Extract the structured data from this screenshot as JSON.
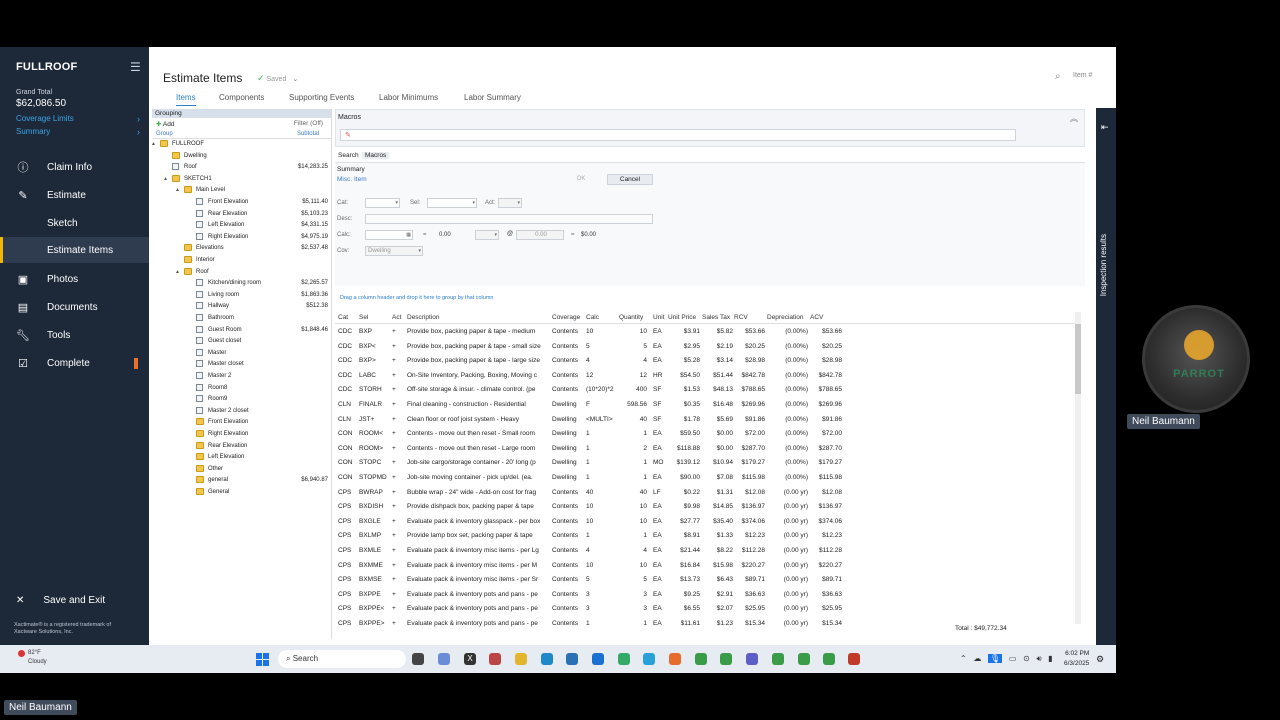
{
  "sidebar": {
    "brand": "FULLROOF",
    "grand_total_label": "Grand Total",
    "grand_total_value": "$62,086.50",
    "coverage_limits": "Coverage Limits",
    "summary": "Summary",
    "items": [
      {
        "label": "Claim Info",
        "icon": "info-icon"
      },
      {
        "label": "Estimate",
        "icon": "pencil-icon"
      },
      {
        "label": "Sketch"
      },
      {
        "label": "Estimate Items"
      },
      {
        "label": "Photos",
        "icon": "photo-icon"
      },
      {
        "label": "Documents",
        "icon": "document-icon"
      },
      {
        "label": "Tools",
        "icon": "wrench-icon"
      },
      {
        "label": "Complete",
        "icon": "checkbox-icon"
      }
    ],
    "save_exit": "Save and Exit",
    "trademark": "Xactimate® is a registered trademark of Xactware Solutions, Inc."
  },
  "header": {
    "title": "Estimate Items",
    "saved": "Saved",
    "item_search": "Item #"
  },
  "tabs": [
    "Items",
    "Components",
    "Supporting Events",
    "Labor Minimums",
    "Labor Summary"
  ],
  "grouping": {
    "title": "Grouping",
    "add": "Add",
    "filter": "Filter (Off)",
    "col_group": "Group",
    "col_subtotal": "Subtotal",
    "tree": [
      {
        "label": "FULLROOF",
        "value": "",
        "type": "folder",
        "level": 0,
        "toggle": "▲"
      },
      {
        "label": "Dwelling",
        "value": "",
        "type": "folder",
        "level": 1,
        "toggle": ""
      },
      {
        "label": "Roof",
        "value": "$14,283.25",
        "type": "room",
        "level": 1,
        "toggle": ""
      },
      {
        "label": "SKETCH1",
        "value": "",
        "type": "folder",
        "level": 1,
        "toggle": "▲"
      },
      {
        "label": "Main Level",
        "value": "",
        "type": "folder",
        "level": 2,
        "toggle": "▲"
      },
      {
        "label": "Front Elevation",
        "value": "$5,111.40",
        "type": "room",
        "level": 3,
        "toggle": ""
      },
      {
        "label": "Rear Elevation",
        "value": "$5,103.23",
        "type": "room",
        "level": 3,
        "toggle": ""
      },
      {
        "label": "Left Elevation",
        "value": "$4,331.15",
        "type": "room",
        "level": 3,
        "toggle": ""
      },
      {
        "label": "Right Elevation",
        "value": "$4,975.19",
        "type": "room",
        "level": 3,
        "toggle": ""
      },
      {
        "label": "Elevations",
        "value": "$2,537.48",
        "type": "folder",
        "level": 2,
        "toggle": ""
      },
      {
        "label": "Interior",
        "value": "",
        "type": "folder",
        "level": 2,
        "toggle": ""
      },
      {
        "label": "Roof",
        "value": "",
        "type": "folder",
        "level": 2,
        "toggle": "▲"
      },
      {
        "label": "Kitchen/dining room",
        "value": "$2,265.57",
        "type": "room",
        "level": 3,
        "toggle": ""
      },
      {
        "label": "Living room",
        "value": "$1,863.36",
        "type": "room",
        "level": 3,
        "toggle": ""
      },
      {
        "label": "Hallway",
        "value": "$512.38",
        "type": "room",
        "level": 3,
        "toggle": ""
      },
      {
        "label": "Bathroom",
        "value": "",
        "type": "room",
        "level": 3,
        "toggle": ""
      },
      {
        "label": "Guest Room",
        "value": "$1,848.46",
        "type": "room",
        "level": 3,
        "toggle": ""
      },
      {
        "label": "Guest closet",
        "value": "",
        "type": "room",
        "level": 3,
        "toggle": ""
      },
      {
        "label": "Master",
        "value": "",
        "type": "room",
        "level": 3,
        "toggle": ""
      },
      {
        "label": "Master closet",
        "value": "",
        "type": "room",
        "level": 3,
        "toggle": ""
      },
      {
        "label": "Master 2",
        "value": "",
        "type": "room",
        "level": 3,
        "toggle": ""
      },
      {
        "label": "Room8",
        "value": "",
        "type": "room",
        "level": 3,
        "toggle": ""
      },
      {
        "label": "Room9",
        "value": "",
        "type": "room",
        "level": 3,
        "toggle": ""
      },
      {
        "label": "Master 2 closet",
        "value": "",
        "type": "room",
        "level": 3,
        "toggle": ""
      },
      {
        "label": "Front Elevation",
        "value": "",
        "type": "folder",
        "level": 3,
        "toggle": ""
      },
      {
        "label": "Right Elevation",
        "value": "",
        "type": "folder",
        "level": 3,
        "toggle": ""
      },
      {
        "label": "Rear Elevation",
        "value": "",
        "type": "folder",
        "level": 3,
        "toggle": ""
      },
      {
        "label": "Left Elevation",
        "value": "",
        "type": "folder",
        "level": 3,
        "toggle": ""
      },
      {
        "label": "Other",
        "value": "",
        "type": "folder",
        "level": 3,
        "toggle": ""
      },
      {
        "label": "general",
        "value": "$6,940.87",
        "type": "folder",
        "level": 3,
        "toggle": ""
      },
      {
        "label": "General",
        "value": "",
        "type": "folder",
        "level": 3,
        "toggle": ""
      }
    ]
  },
  "macros": {
    "title": "Macros",
    "subtab_search": "Search",
    "subtab_macros": "Macros"
  },
  "summary": {
    "title": "Summary",
    "misc_item": "Misc. Item",
    "ok": "OK",
    "cancel": "Cancel",
    "cat_label": "Cat:",
    "sel_label": "Sel:",
    "act_label": "Act:",
    "desc_label": "Desc:",
    "calc_label": "Calc:",
    "cov_label": "Cov:",
    "calc_eq": "=",
    "calc_value": "0.00",
    "unit_price": "0.00",
    "at_sign": "@",
    "total_eq": "=",
    "total": "$0.00",
    "cov_value": "Dwelling"
  },
  "grid": {
    "hint": "Drag a column header and drop it here to group by that column",
    "headers": [
      "Cat",
      "Sel",
      "Act",
      "Description",
      "Coverage",
      "Calc",
      "Quantity",
      "Unit",
      "Unit Price",
      "Sales Tax",
      "RCV",
      "Depreciation",
      "ACV"
    ],
    "rows": [
      [
        "CDC",
        "BXP",
        "+",
        "Provide box, packing paper & tape - medium",
        "Contents",
        "10",
        "10",
        "EA",
        "$3.91",
        "$5.82",
        "$53.66",
        "(0.00%)",
        "$53.66"
      ],
      [
        "CDC",
        "BXP<",
        "+",
        "Provide box, packing paper & tape - small size",
        "Contents",
        "5",
        "5",
        "EA",
        "$2.95",
        "$2.19",
        "$20.25",
        "(0.00%)",
        "$20.25"
      ],
      [
        "CDC",
        "BXP>",
        "+",
        "Provide box, packing paper & tape - large size",
        "Contents",
        "4",
        "4",
        "EA",
        "$5.28",
        "$3.14",
        "$28.98",
        "(0.00%)",
        "$28.98"
      ],
      [
        "CDC",
        "LABC",
        "+",
        "On-Site Inventory, Packing, Boxing, Moving c",
        "Contents",
        "12",
        "12",
        "HR",
        "$54.50",
        "$51.44",
        "$842.78",
        "(0.00%)",
        "$842.78"
      ],
      [
        "CDC",
        "STORH",
        "+",
        "Off-site storage & insur. - climate control. (pe",
        "Contents",
        "(10*20)*2",
        "400",
        "SF",
        "$1.53",
        "$48.13",
        "$788.65",
        "(0.00%)",
        "$788.65"
      ],
      [
        "CLN",
        "FINALR",
        "+",
        "Final cleaning - construction - Residential",
        "Dwelling",
        "F",
        "598.56",
        "SF",
        "$0.35",
        "$16.48",
        "$269.96",
        "(0.00%)",
        "$269.96"
      ],
      [
        "CLN",
        "JST+",
        "+",
        "Clean floor or roof joist system - Heavy",
        "Dwelling",
        "<MULTI>",
        "40",
        "SF",
        "$1.78",
        "$5.69",
        "$91.86",
        "(0.00%)",
        "$91.86"
      ],
      [
        "CON",
        "ROOM<",
        "+",
        "Contents - move out then reset - Small room",
        "Dwelling",
        "1",
        "1",
        "EA",
        "$59.50",
        "$0.00",
        "$72.00",
        "(0.00%)",
        "$72.00"
      ],
      [
        "CON",
        "ROOM>",
        "+",
        "Contents - move out then reset - Large room",
        "Dwelling",
        "1",
        "2",
        "EA",
        "$118.88",
        "$0.00",
        "$287.70",
        "(0.00%)",
        "$287.70"
      ],
      [
        "CON",
        "STOPC",
        "+",
        "Job-site cargo/storage container - 20' long (p",
        "Dwelling",
        "1",
        "1",
        "MO",
        "$139.12",
        "$10.94",
        "$179.27",
        "(0.00%)",
        "$179.27"
      ],
      [
        "CON",
        "STOPMD",
        "+",
        "Job-site moving container - pick up/del. (ea.",
        "Dwelling",
        "1",
        "1",
        "EA",
        "$90.00",
        "$7.08",
        "$115.98",
        "(0.00%)",
        "$115.98"
      ],
      [
        "CPS",
        "BWRAP",
        "+",
        "Bubble wrap - 24\" wide - Add-on cost for frag",
        "Contents",
        "40",
        "40",
        "LF",
        "$0.22",
        "$1.31",
        "$12.08",
        "(0.00 yr)",
        "$12.08"
      ],
      [
        "CPS",
        "BXDISH",
        "+",
        "Provide dishpack box, packing paper & tape",
        "Contents",
        "10",
        "10",
        "EA",
        "$9.98",
        "$14.85",
        "$136.97",
        "(0.00 yr)",
        "$136.97"
      ],
      [
        "CPS",
        "BXGLE",
        "+",
        "Evaluate pack & inventory glasspack - per box",
        "Contents",
        "10",
        "10",
        "EA",
        "$27.77",
        "$35.40",
        "$374.06",
        "(0.00 yr)",
        "$374.06"
      ],
      [
        "CPS",
        "BXLMP",
        "+",
        "Provide lamp box set, packing paper & tape",
        "Contents",
        "1",
        "1",
        "EA",
        "$8.91",
        "$1.33",
        "$12.23",
        "(0.00 yr)",
        "$12.23"
      ],
      [
        "CPS",
        "BXMLE",
        "+",
        "Evaluate pack & inventory misc items - per Lg",
        "Contents",
        "4",
        "4",
        "EA",
        "$21.44",
        "$8.22",
        "$112.28",
        "(0.00 yr)",
        "$112.28"
      ],
      [
        "CPS",
        "BXMME",
        "+",
        "Evaluate pack & inventory misc items - per M",
        "Contents",
        "10",
        "10",
        "EA",
        "$16.84",
        "$15.98",
        "$220.27",
        "(0.00 yr)",
        "$220.27"
      ],
      [
        "CPS",
        "BXMSE",
        "+",
        "Evaluate pack & inventory misc items - per Sr",
        "Contents",
        "5",
        "5",
        "EA",
        "$13.73",
        "$6.43",
        "$89.71",
        "(0.00 yr)",
        "$89.71"
      ],
      [
        "CPS",
        "BXPPE",
        "+",
        "Evaluate pack & inventory pots and pans - pe",
        "Contents",
        "3",
        "3",
        "EA",
        "$9.25",
        "$2.91",
        "$36.63",
        "(0.00 yr)",
        "$36.63"
      ],
      [
        "CPS",
        "BXPPE<",
        "+",
        "Evaluate pack & inventory pots and pans - pe",
        "Contents",
        "3",
        "3",
        "EA",
        "$6.55",
        "$2.07",
        "$25.95",
        "(0.00 yr)",
        "$25.95"
      ],
      [
        "CPS",
        "BXPPE>",
        "+",
        "Evaluate pack & inventory pots and pans - pe",
        "Contents",
        "1",
        "1",
        "EA",
        "$11.61",
        "$1.23",
        "$15.34",
        "(0.00 yr)",
        "$15.34"
      ]
    ],
    "total": "Total : $49,772.34"
  },
  "inspection": {
    "label": "Inspection results"
  },
  "taskbar": {
    "temp": "82°F",
    "condition": "Cloudy",
    "search": "Search",
    "time": "6:02 PM",
    "date": "6/3/2025"
  },
  "logo_text": "PARROT",
  "participant_right": "Neil Baumann",
  "participant_left": "Neil Baumann"
}
